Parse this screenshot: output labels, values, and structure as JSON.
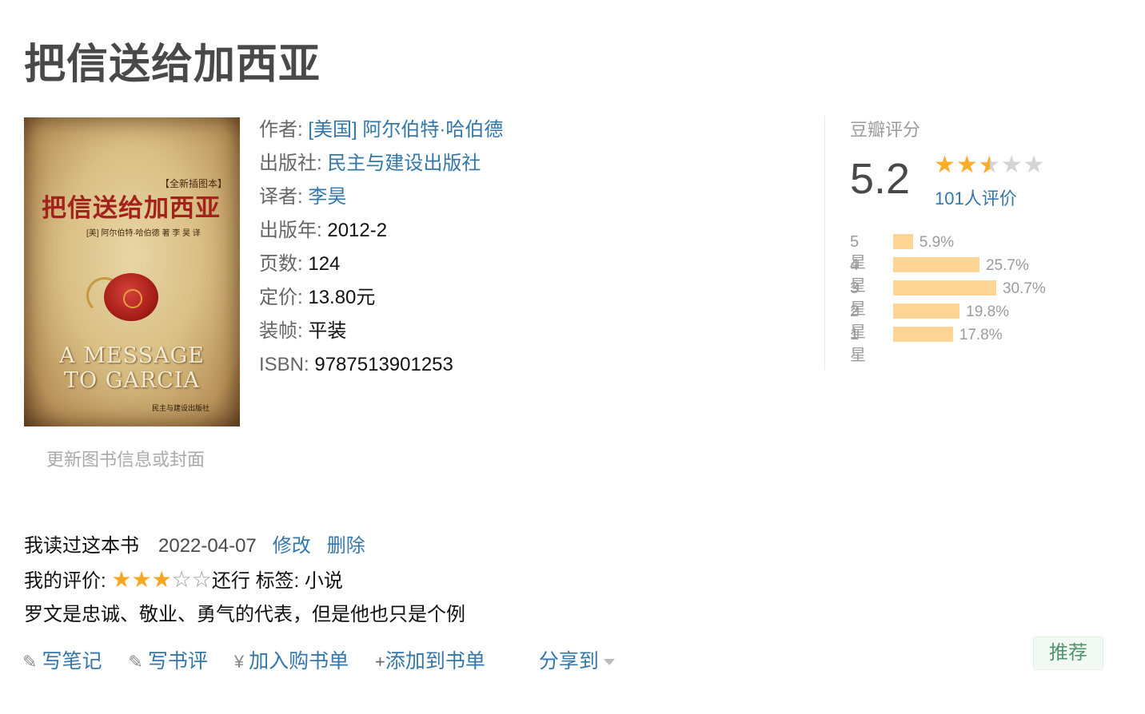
{
  "book": {
    "title": "把信送给加西亚",
    "cover": {
      "tag": "【全新插图本】",
      "title": "把信送给加西亚",
      "line": "[美] 阿尔伯特·哈伯德 著    李 昊 译",
      "english": [
        "A MESSAGE",
        "TO GARCIA"
      ],
      "publisher": "民主与建设出版社"
    },
    "update_link": "更新图书信息或封面",
    "info": {
      "author_label": "作者:",
      "author": "[美国] 阿尔伯特·哈伯德",
      "publisher_label": "出版社:",
      "publisher": "民主与建设出版社",
      "translator_label": "译者:",
      "translator": "李昊",
      "year_label": "出版年:",
      "year": "2012-2",
      "pages_label": "页数:",
      "pages": "124",
      "price_label": "定价:",
      "price": "13.80元",
      "binding_label": "装帧:",
      "binding": "平装",
      "isbn_label": "ISBN:",
      "isbn": "9787513901253"
    }
  },
  "rating": {
    "heading": "豆瓣评分",
    "score": "5.2",
    "stars_value": 2.5,
    "count": "101人评价",
    "bar_color": "#ffd596",
    "distribution": [
      {
        "label": "5星",
        "percent": "5.9%",
        "value": 5.9
      },
      {
        "label": "4星",
        "percent": "25.7%",
        "value": 25.7
      },
      {
        "label": "3星",
        "percent": "30.7%",
        "value": 30.7
      },
      {
        "label": "2星",
        "percent": "19.8%",
        "value": 19.8
      },
      {
        "label": "1星",
        "percent": "17.8%",
        "value": 17.8
      }
    ]
  },
  "my_reading": {
    "status": "我读过这本书",
    "date": "2022-04-07",
    "edit": "修改",
    "delete": "删除",
    "rating_label": "我的评价:",
    "my_stars": 3,
    "rating_text": "还行",
    "tags_label": "标签:",
    "tags": "小说",
    "comment": "罗文是忠诚、敬业、勇气的代表，但是他也只是个例"
  },
  "actions": {
    "write_note": "写笔记",
    "write_review": "写书评",
    "add_cart": "加入购书单",
    "add_list": "添加到书单",
    "share": "分享到",
    "recommend": "推荐"
  }
}
